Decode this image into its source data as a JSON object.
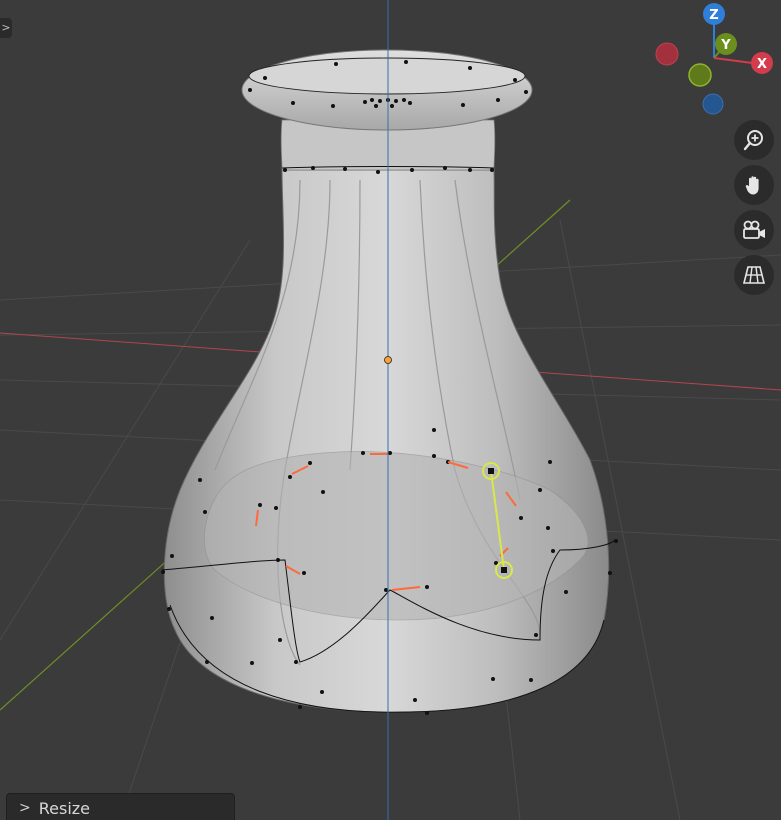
{
  "viewport": {
    "background": "#3b3b3b",
    "sidebar_toggle": ">",
    "axis_colors": {
      "x": "#c0464e",
      "y": "#7a9a2a",
      "z": "#3b6fb0"
    }
  },
  "gizmo": {
    "z_label": "Z",
    "y_label": "Y",
    "x_label": "X",
    "colors": {
      "z": "#2f7fd8",
      "y": "#6b8f1c",
      "x": "#d23c4d",
      "neg_x": "#a3303d",
      "neg_y": "#5e7a1a",
      "neg_z": "#24568f"
    }
  },
  "nav_buttons": [
    {
      "name": "zoom",
      "icon": "zoom-icon"
    },
    {
      "name": "pan",
      "icon": "hand-icon"
    },
    {
      "name": "camera",
      "icon": "camera-icon"
    },
    {
      "name": "perspective",
      "icon": "grid-icon"
    }
  ],
  "operator_panel": {
    "label": "Resize",
    "chevron": ">"
  },
  "mesh": {
    "selection_color": "#d8e84a",
    "handle_color": "#ff6a3a",
    "origin_color": "#ffa030"
  }
}
